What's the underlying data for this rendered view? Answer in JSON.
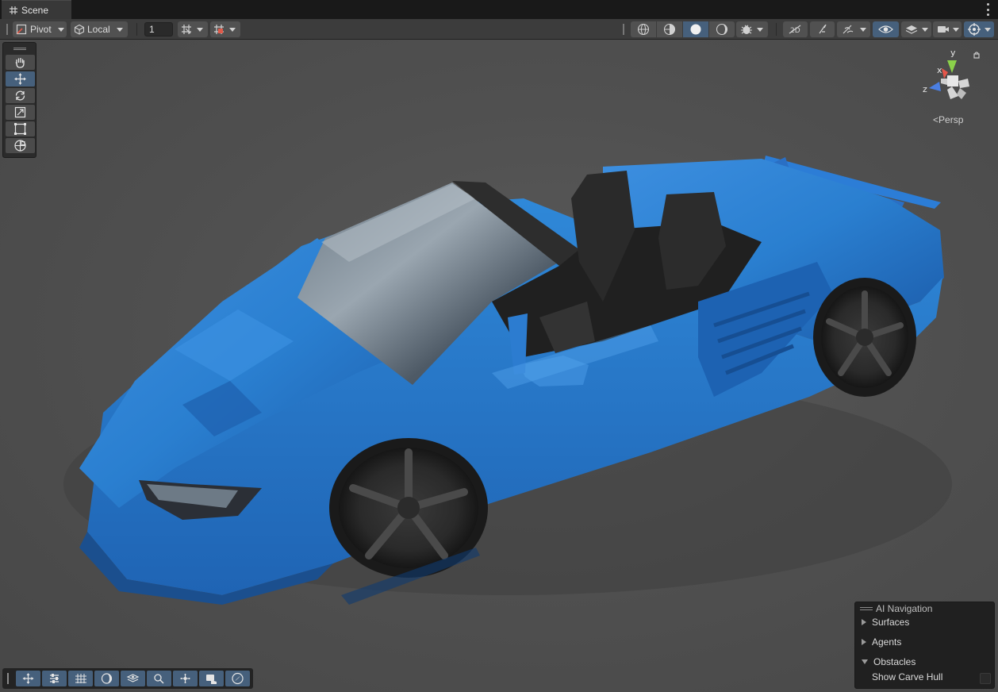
{
  "window": {
    "tab_title": "Scene"
  },
  "toolbar": {
    "pivot_label": "Pivot",
    "local_label": "Local",
    "grid_size_value": "1",
    "left_icons": [
      "grid-snap-icon",
      "increment-snap-icon"
    ],
    "right_icons": [
      "wireframe-icon",
      "shaded-wireframe-icon",
      "shaded-icon",
      "unlit-icon",
      "debug-draw-icon",
      "2d-toggle-icon",
      "lighting-toggle-icon",
      "effects-icon",
      "visibility-icon",
      "layers-icon",
      "camera-icon",
      "gizmos-icon"
    ]
  },
  "tool_palette": {
    "tools": [
      "hand-icon",
      "move-icon",
      "rotate-icon",
      "scale-icon",
      "rect-icon",
      "transform-icon"
    ],
    "selected": "move-icon"
  },
  "gizmo": {
    "axis_y": "y",
    "axis_x": "x",
    "axis_z": "z",
    "projection_label": "Persp",
    "colors": {
      "y": "#8bd14a",
      "x": "#e5564a",
      "z": "#4b7fe2"
    }
  },
  "bottom_toolbar": {
    "tools": [
      "move-icon",
      "sliders-icon",
      "grid-icon",
      "shading-icon",
      "navmesh-icon",
      "search-icon",
      "pan-icon",
      "camera-preview-icon",
      "compass-icon"
    ]
  },
  "ai_navigation": {
    "title": "AI Navigation",
    "surfaces": "Surfaces",
    "agents": "Agents",
    "obstacles": "Obstacles",
    "show_carve_hull": "Show Carve Hull",
    "show_carve_hull_checked": false
  },
  "scene": {
    "object": "Car model",
    "body_color": "#2a7fd0"
  }
}
